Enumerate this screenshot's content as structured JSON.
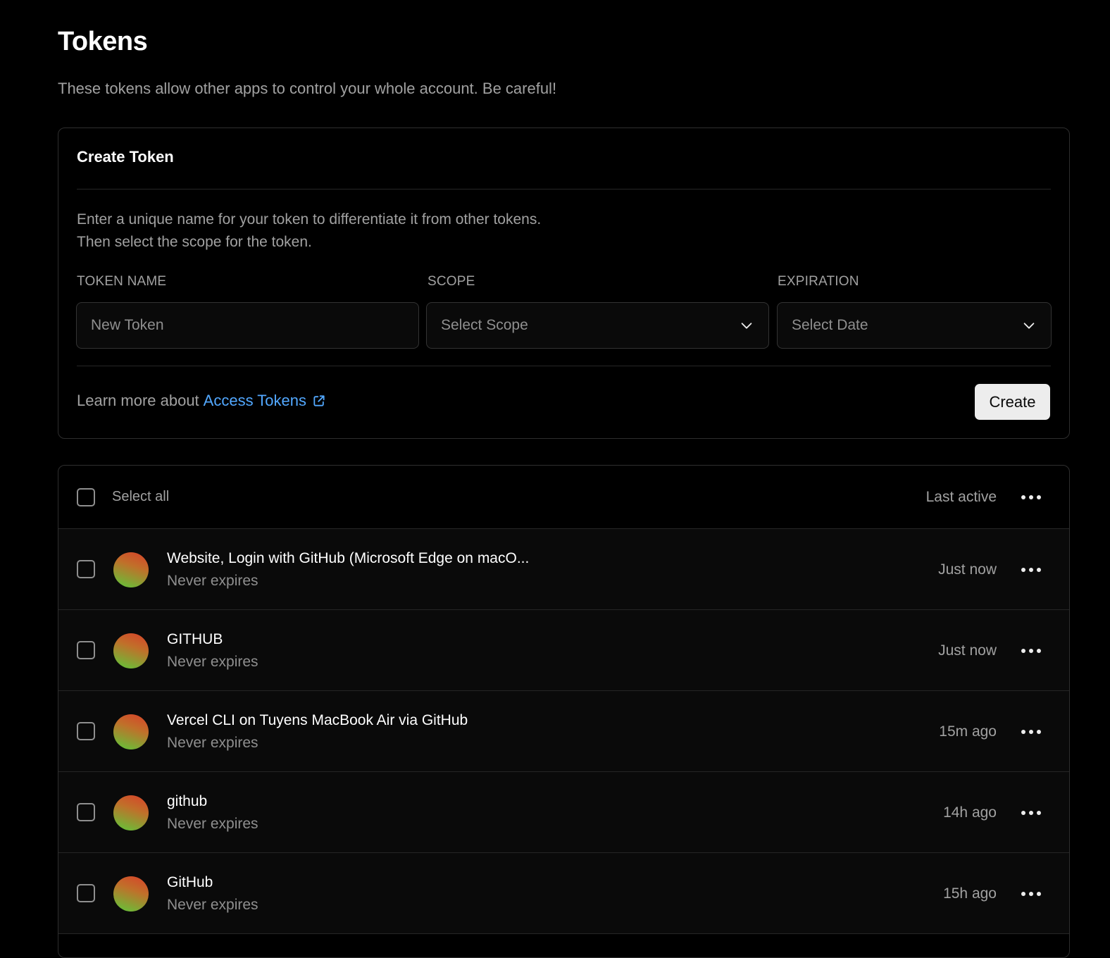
{
  "page": {
    "title": "Tokens",
    "subtitle": "These tokens allow other apps to control your whole account. Be careful!"
  },
  "create_token": {
    "title": "Create Token",
    "description_line1": "Enter a unique name for your token to differentiate it from other tokens.",
    "description_line2": "Then select the scope for the token.",
    "name_label": "TOKEN NAME",
    "name_placeholder": "New Token",
    "scope_label": "SCOPE",
    "scope_value": "Select Scope",
    "expiration_label": "EXPIRATION",
    "expiration_value": "Select Date",
    "learn_more_text": "Learn more about",
    "learn_more_link": "Access Tokens",
    "create_button": "Create"
  },
  "token_list": {
    "select_all_label": "Select all",
    "last_active_label": "Last active",
    "tokens": [
      {
        "name": "Website, Login with GitHub (Microsoft Edge on macO...",
        "expires": "Never expires",
        "last_active": "Just now"
      },
      {
        "name": "GITHUB",
        "expires": "Never expires",
        "last_active": "Just now"
      },
      {
        "name": "Vercel CLI on Tuyens MacBook Air via GitHub",
        "expires": "Never expires",
        "last_active": "15m ago"
      },
      {
        "name": "github",
        "expires": "Never expires",
        "last_active": "14h ago"
      },
      {
        "name": "GitHub",
        "expires": "Never expires",
        "last_active": "15h ago"
      }
    ]
  },
  "colors": {
    "background": "#000000",
    "link": "#52a8ff",
    "muted_text": "#a1a1a1",
    "button_bg": "#ededed"
  },
  "icons": {
    "chevron": "chevron-down-icon",
    "external_link": "external-link-icon",
    "more": "more-horizontal-icon",
    "avatar": "gradient-avatar"
  }
}
